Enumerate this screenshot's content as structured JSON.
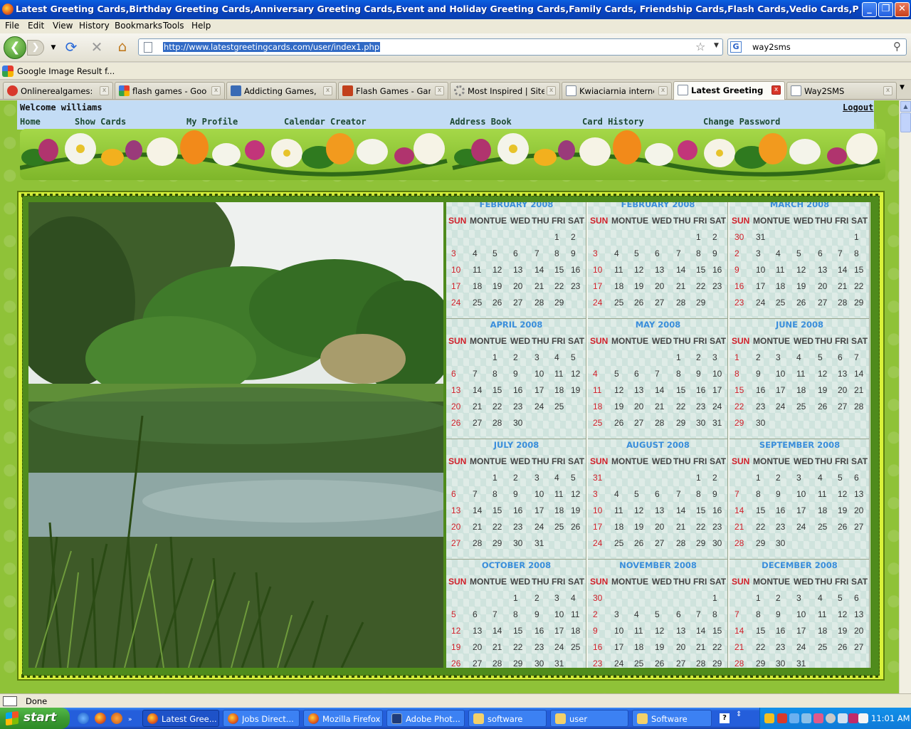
{
  "window": {
    "title": "Latest Greeting Cards,Birthday Greeting Cards,Anniversary Greeting Cards,Event and Holiday Greeting Cards,Family Cards, Friendship Cards,Flash Cards,Vedio Cards,Printable Cards - Mozi...",
    "minimize": "_",
    "maximize": "❐",
    "close": "✕"
  },
  "menu": [
    "File",
    "Edit",
    "View",
    "History",
    "Bookmarks",
    "Tools",
    "Help"
  ],
  "toolbar": {
    "url": "http://www.latestgreetingcards.com/user/index1.php",
    "search_query": "way2sms",
    "search_engine_icon": "G"
  },
  "bookmark": {
    "label": "Google Image Result f..."
  },
  "tabs": [
    {
      "label": "Onlinerealgames:Pl...",
      "icon": "chrome-icon",
      "color": "#d8382c",
      "active": false
    },
    {
      "label": "flash games - Googl...",
      "icon": "google-icon",
      "color": "#3e79e3",
      "active": false
    },
    {
      "label": "Addicting Games, Fl...",
      "icon": "addicting-games-icon",
      "color": "#3a6bb5",
      "active": false
    },
    {
      "label": "Flash Games - Gam...",
      "icon": "flash-games-icon",
      "color": "#c2401c",
      "active": false
    },
    {
      "label": "Most Inspired | Sites",
      "icon": "loading-icon",
      "color": "#888888",
      "active": false
    },
    {
      "label": "Kwiaciarnia internet...",
      "icon": "page-icon",
      "color": "#ffffff",
      "active": false
    },
    {
      "label": "Latest Greeting ...",
      "icon": "page-icon",
      "color": "#ffffff",
      "active": true
    },
    {
      "label": "Way2SMS",
      "icon": "page-icon",
      "color": "#ffffff",
      "active": false
    }
  ],
  "site": {
    "welcome": "Welcome williams",
    "logout": "Logout",
    "nav": [
      "Home",
      "Show Cards",
      "My Profile",
      "Calendar Creator",
      "Address Book",
      "Card History",
      "Change Password"
    ]
  },
  "calendar": {
    "weekdays": [
      "SUN",
      "MON",
      "TUE",
      "WED",
      "THU",
      "FRI",
      "SAT"
    ],
    "months": [
      {
        "title": "FEBRUARY 2008",
        "weeks": [
          [
            "",
            "",
            "",
            "",
            "",
            "1",
            "2"
          ],
          [
            "3",
            "4",
            "5",
            "6",
            "7",
            "8",
            "9"
          ],
          [
            "10",
            "11",
            "12",
            "13",
            "14",
            "15",
            "16"
          ],
          [
            "17",
            "18",
            "19",
            "20",
            "21",
            "22",
            "23"
          ],
          [
            "24",
            "25",
            "26",
            "27",
            "28",
            "29",
            ""
          ]
        ]
      },
      {
        "title": "FEBRUARY 2008",
        "weeks": [
          [
            "",
            "",
            "",
            "",
            "",
            "1",
            "2"
          ],
          [
            "3",
            "4",
            "5",
            "6",
            "7",
            "8",
            "9"
          ],
          [
            "10",
            "11",
            "12",
            "13",
            "14",
            "15",
            "16"
          ],
          [
            "17",
            "18",
            "19",
            "20",
            "21",
            "22",
            "23"
          ],
          [
            "24",
            "25",
            "26",
            "27",
            "28",
            "29",
            ""
          ]
        ]
      },
      {
        "title": "MARCH 2008",
        "weeks": [
          [
            "30",
            "31",
            "",
            "",
            "",
            "",
            "1"
          ],
          [
            "2",
            "3",
            "4",
            "5",
            "6",
            "7",
            "8"
          ],
          [
            "9",
            "10",
            "11",
            "12",
            "13",
            "14",
            "15"
          ],
          [
            "16",
            "17",
            "18",
            "19",
            "20",
            "21",
            "22"
          ],
          [
            "23",
            "24",
            "25",
            "26",
            "27",
            "28",
            "29"
          ]
        ]
      },
      {
        "title": "APRIL 2008",
        "weeks": [
          [
            "",
            "",
            "1",
            "2",
            "3",
            "4",
            "5"
          ],
          [
            "6",
            "7",
            "8",
            "9",
            "10",
            "11",
            "12"
          ],
          [
            "13",
            "14",
            "15",
            "16",
            "17",
            "18",
            "19"
          ],
          [
            "20",
            "21",
            "22",
            "23",
            "24",
            "25",
            ""
          ],
          [
            "26",
            "27",
            "28",
            "30",
            "",
            "",
            ""
          ]
        ]
      },
      {
        "title": "MAY 2008",
        "weeks": [
          [
            "",
            "",
            "",
            "",
            "1",
            "2",
            "3"
          ],
          [
            "4",
            "5",
            "6",
            "7",
            "8",
            "9",
            "10"
          ],
          [
            "11",
            "12",
            "13",
            "14",
            "15",
            "16",
            "17"
          ],
          [
            "18",
            "19",
            "20",
            "21",
            "22",
            "23",
            "24"
          ],
          [
            "25",
            "26",
            "27",
            "28",
            "29",
            "30",
            "31"
          ]
        ]
      },
      {
        "title": "JUNE 2008",
        "weeks": [
          [
            "1",
            "2",
            "3",
            "4",
            "5",
            "6",
            "7"
          ],
          [
            "8",
            "9",
            "10",
            "11",
            "12",
            "13",
            "14"
          ],
          [
            "15",
            "16",
            "17",
            "18",
            "19",
            "20",
            "21"
          ],
          [
            "22",
            "23",
            "24",
            "25",
            "26",
            "27",
            "28"
          ],
          [
            "29",
            "30",
            "",
            "",
            "",
            "",
            ""
          ]
        ]
      },
      {
        "title": "JULY 2008",
        "weeks": [
          [
            "",
            "",
            "1",
            "2",
            "3",
            "4",
            "5"
          ],
          [
            "6",
            "7",
            "8",
            "9",
            "10",
            "11",
            "12"
          ],
          [
            "13",
            "14",
            "15",
            "16",
            "17",
            "18",
            "19"
          ],
          [
            "20",
            "21",
            "22",
            "23",
            "24",
            "25",
            "26"
          ],
          [
            "27",
            "28",
            "29",
            "30",
            "31",
            "",
            ""
          ]
        ]
      },
      {
        "title": "AUGUST 2008",
        "weeks": [
          [
            "31",
            "",
            "",
            "",
            "",
            "1",
            "2"
          ],
          [
            "3",
            "4",
            "5",
            "6",
            "7",
            "8",
            "9"
          ],
          [
            "10",
            "11",
            "12",
            "13",
            "14",
            "15",
            "16"
          ],
          [
            "17",
            "18",
            "19",
            "20",
            "21",
            "22",
            "23"
          ],
          [
            "24",
            "25",
            "26",
            "27",
            "28",
            "29",
            "30"
          ]
        ]
      },
      {
        "title": "SEPTEMBER 2008",
        "weeks": [
          [
            "",
            "1",
            "2",
            "3",
            "4",
            "5",
            "6"
          ],
          [
            "7",
            "8",
            "9",
            "10",
            "11",
            "12",
            "13"
          ],
          [
            "14",
            "15",
            "16",
            "17",
            "18",
            "19",
            "20"
          ],
          [
            "21",
            "22",
            "23",
            "24",
            "25",
            "26",
            "27"
          ],
          [
            "28",
            "29",
            "30",
            "",
            "",
            "",
            ""
          ]
        ]
      },
      {
        "title": "OCTOBER 2008",
        "weeks": [
          [
            "",
            "",
            "",
            "1",
            "2",
            "3",
            "4"
          ],
          [
            "5",
            "6",
            "7",
            "8",
            "9",
            "10",
            "11"
          ],
          [
            "12",
            "13",
            "14",
            "15",
            "16",
            "17",
            "18"
          ],
          [
            "19",
            "20",
            "21",
            "22",
            "23",
            "24",
            "25"
          ],
          [
            "26",
            "27",
            "28",
            "29",
            "30",
            "31",
            ""
          ]
        ]
      },
      {
        "title": "NOVEMBER 2008",
        "weeks": [
          [
            "30",
            "",
            "",
            "",
            "",
            "",
            "1"
          ],
          [
            "2",
            "3",
            "4",
            "5",
            "6",
            "7",
            "8"
          ],
          [
            "9",
            "10",
            "11",
            "12",
            "13",
            "14",
            "15"
          ],
          [
            "16",
            "17",
            "18",
            "19",
            "20",
            "21",
            "22"
          ],
          [
            "23",
            "24",
            "25",
            "26",
            "27",
            "28",
            "29"
          ]
        ]
      },
      {
        "title": "DECEMBER 2008",
        "weeks": [
          [
            "",
            "1",
            "2",
            "3",
            "4",
            "5",
            "6"
          ],
          [
            "7",
            "8",
            "9",
            "10",
            "11",
            "12",
            "13"
          ],
          [
            "14",
            "15",
            "16",
            "17",
            "18",
            "19",
            "20"
          ],
          [
            "21",
            "22",
            "23",
            "24",
            "25",
            "26",
            "27"
          ],
          [
            "28",
            "29",
            "30",
            "31",
            "",
            "",
            ""
          ]
        ]
      }
    ]
  },
  "status": {
    "text": "Done"
  },
  "taskbar": {
    "start": "start",
    "quicklaunch": [
      "ie-icon",
      "firefox-icon",
      "media-icon"
    ],
    "windows": [
      {
        "label": "Latest Gree...",
        "icon": "firefox-icon",
        "active": true
      },
      {
        "label": "Jobs Direct...",
        "icon": "firefox-icon",
        "active": false
      },
      {
        "label": "Mozilla Firefox",
        "icon": "firefox-icon",
        "active": false
      },
      {
        "label": "Adobe Phot...",
        "icon": "photoshop-icon",
        "active": false
      },
      {
        "label": "software",
        "icon": "folder-icon",
        "active": false
      },
      {
        "label": "user",
        "icon": "folder-icon",
        "active": false
      },
      {
        "label": "Software",
        "icon": "folder-icon",
        "active": false
      }
    ],
    "clock": "11:01 AM"
  }
}
